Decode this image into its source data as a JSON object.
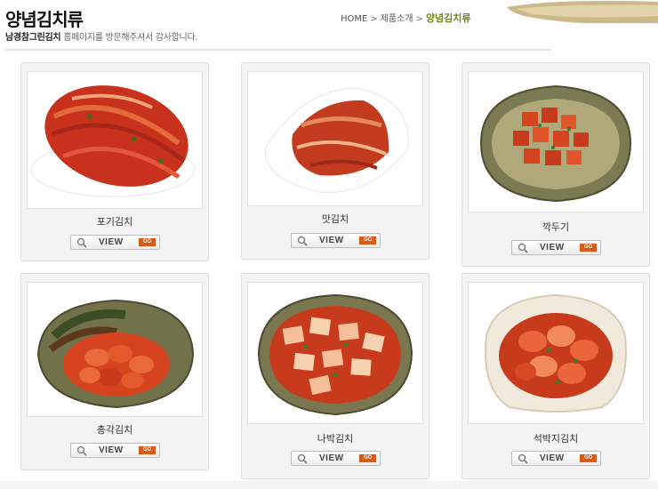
{
  "header": {
    "title": "양념김치류",
    "subtitle_brand": "남경참그린김치",
    "subtitle_text": " 홈페이지를 방문해주셔서 감사합니다."
  },
  "breadcrumb": {
    "home": "HOME",
    "separator": ">",
    "parent": "제품소개",
    "current": "양념김치류"
  },
  "products": [
    {
      "name": "포기김치",
      "view_label": "VIEW",
      "go_label": "GO"
    },
    {
      "name": "맛김치",
      "view_label": "VIEW",
      "go_label": "GO"
    },
    {
      "name": "깍두기",
      "view_label": "VIEW",
      "go_label": "GO"
    },
    {
      "name": "총각김치",
      "view_label": "VIEW",
      "go_label": "GO"
    },
    {
      "name": "나박김치",
      "view_label": "VIEW",
      "go_label": "GO"
    },
    {
      "name": "석박지김치",
      "view_label": "VIEW",
      "go_label": "GO"
    }
  ],
  "colors": {
    "accent": "#6a8a1a",
    "go_button": "#d85a14",
    "kimchi_red": "#c8321c"
  }
}
